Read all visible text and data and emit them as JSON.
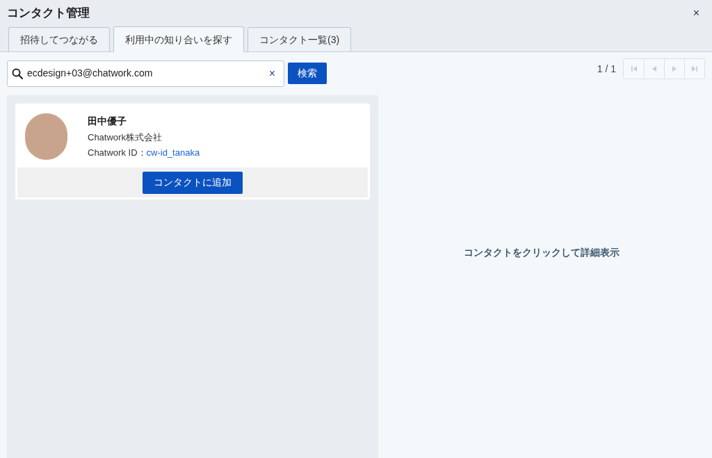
{
  "window": {
    "title": "コンタクト管理",
    "close": "×"
  },
  "tabs": [
    {
      "label": "招待してつながる",
      "selected": false
    },
    {
      "label": "利用中の知り合いを探す",
      "selected": true
    },
    {
      "label": "コンタクト一覧(3)",
      "selected": false
    }
  ],
  "search": {
    "value": "ecdesign+03@chatwork.com",
    "clear": "×",
    "button": "検索"
  },
  "pager": {
    "text": "1 / 1",
    "buttons": [
      {
        "kind": "first",
        "disabled": true
      },
      {
        "kind": "prev",
        "disabled": true
      },
      {
        "kind": "next",
        "disabled": true
      },
      {
        "kind": "last",
        "disabled": true
      }
    ]
  },
  "results": [
    {
      "name": "田中優子",
      "company": "Chatwork株式会社",
      "id_label": "Chatwork ID：",
      "id": "cw-id_tanaka",
      "button": "コンタクトに追加"
    }
  ],
  "detail": {
    "hint": "コンタクトをクリックして詳細表示"
  }
}
